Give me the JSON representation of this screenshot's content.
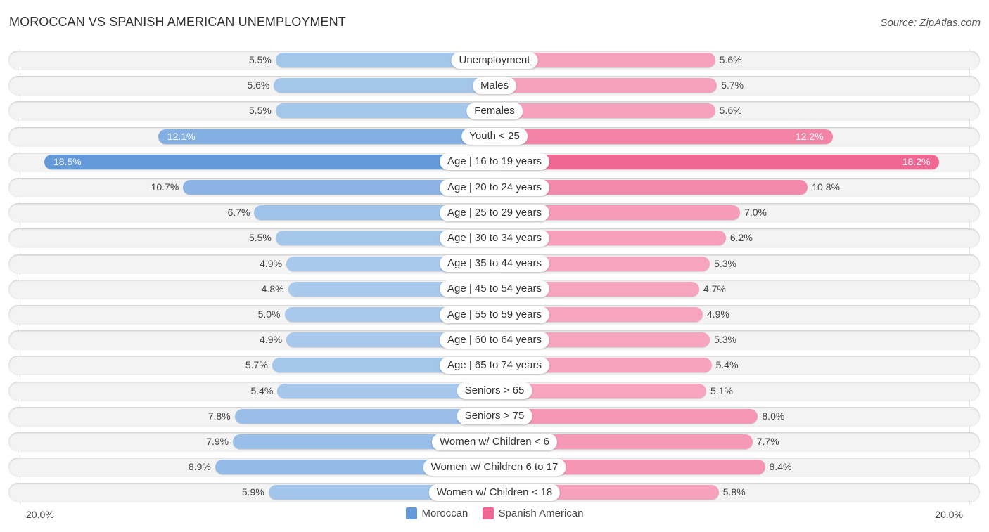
{
  "header": {
    "title": "MOROCCAN VS SPANISH AMERICAN UNEMPLOYMENT",
    "source": "Source: ZipAtlas.com"
  },
  "colors": {
    "moroccan_light": "#a8c8ec",
    "moroccan_dark": "#6399d9",
    "spanish_light": "#f7a5bf",
    "spanish_dark": "#f06892"
  },
  "chart_data": {
    "type": "bar",
    "orientation": "horizontal-diverging",
    "title": "MOROCCAN VS SPANISH AMERICAN UNEMPLOYMENT",
    "xlabel": "",
    "ylabel": "",
    "axis_min_label": "20.0%",
    "axis_max_label": "20.0%",
    "xlim": [
      0,
      20
    ],
    "unit": "%",
    "legend_position": "bottom-center",
    "categories": [
      "Unemployment",
      "Males",
      "Females",
      "Youth < 25",
      "Age | 16 to 19 years",
      "Age | 20 to 24 years",
      "Age | 25 to 29 years",
      "Age | 30 to 34 years",
      "Age | 35 to 44 years",
      "Age | 45 to 54 years",
      "Age | 55 to 59 years",
      "Age | 60 to 64 years",
      "Age | 65 to 74 years",
      "Seniors > 65",
      "Seniors > 75",
      "Women w/ Children < 6",
      "Women w/ Children 6 to 17",
      "Women w/ Children < 18"
    ],
    "series": [
      {
        "name": "Moroccan",
        "side": "left",
        "values": [
          5.5,
          5.6,
          5.5,
          12.1,
          18.5,
          10.7,
          6.7,
          5.5,
          4.9,
          4.8,
          5.0,
          4.9,
          5.7,
          5.4,
          7.8,
          7.9,
          8.9,
          5.9
        ],
        "labels": [
          "5.5%",
          "5.6%",
          "5.5%",
          "12.1%",
          "18.5%",
          "10.7%",
          "6.7%",
          "5.5%",
          "4.9%",
          "4.8%",
          "5.0%",
          "4.9%",
          "5.7%",
          "5.4%",
          "7.8%",
          "7.9%",
          "8.9%",
          "5.9%"
        ]
      },
      {
        "name": "Spanish American",
        "side": "right",
        "values": [
          5.6,
          5.7,
          5.6,
          12.2,
          18.2,
          10.8,
          7.0,
          6.2,
          5.3,
          4.7,
          4.9,
          5.3,
          5.4,
          5.1,
          8.0,
          7.7,
          8.4,
          5.8
        ],
        "labels": [
          "5.6%",
          "5.7%",
          "5.6%",
          "12.2%",
          "18.2%",
          "10.8%",
          "7.0%",
          "6.2%",
          "5.3%",
          "4.7%",
          "4.9%",
          "5.3%",
          "5.4%",
          "5.1%",
          "8.0%",
          "7.7%",
          "8.4%",
          "5.8%"
        ]
      }
    ]
  },
  "legend": {
    "items": [
      {
        "label": "Moroccan",
        "color": "#6399d9"
      },
      {
        "label": "Spanish American",
        "color": "#f06892"
      }
    ]
  }
}
